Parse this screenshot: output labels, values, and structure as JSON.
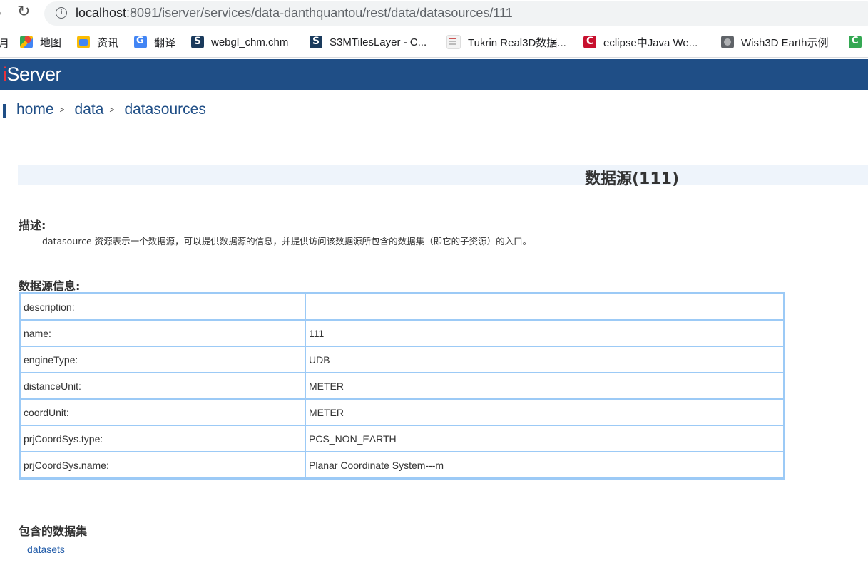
{
  "browser": {
    "url_host": "localhost",
    "url_path": ":8091/iserver/services/data-danthquantou/rest/data/datasources/111",
    "bookmarks_cut": "月",
    "bookmarks": [
      {
        "label": "地图",
        "icon": "maps-icon"
      },
      {
        "label": "资讯",
        "icon": "news-icon"
      },
      {
        "label": "翻译",
        "icon": "translate-icon"
      },
      {
        "label": "webgl_chm.chm",
        "icon": "supermap-icon"
      },
      {
        "label": "S3MTilesLayer - C...",
        "icon": "supermap-icon"
      },
      {
        "label": "Tukrin Real3D数据...",
        "icon": "document-icon"
      },
      {
        "label": "eclipse中Java We...",
        "icon": "eclipse-icon"
      },
      {
        "label": "Wish3D Earth示例",
        "icon": "globe-icon"
      }
    ]
  },
  "header": {
    "logo_i": "i",
    "logo_rest": "Server"
  },
  "breadcrumb": {
    "items": [
      "home",
      "data",
      "datasources"
    ],
    "sep": ">"
  },
  "page": {
    "title": "数据源(111)",
    "desc_heading": "描述:",
    "desc_text": "datasource 资源表示一个数据源，可以提供数据源的信息，并提供访问该数据源所包含的数据集（即它的子资源）的入口。",
    "info_heading": "数据源信息:",
    "info_rows": [
      {
        "key": "description:",
        "value": ""
      },
      {
        "key": "name:",
        "value": "111"
      },
      {
        "key": "engineType:",
        "value": "UDB"
      },
      {
        "key": "distanceUnit:",
        "value": "METER"
      },
      {
        "key": "coordUnit:",
        "value": "METER"
      },
      {
        "key": "prjCoordSys.type:",
        "value": "PCS_NON_EARTH"
      },
      {
        "key": "prjCoordSys.name:",
        "value": "Planar Coordinate System---m"
      }
    ],
    "datasets_heading": "包含的数据集",
    "datasets_link": "datasets"
  },
  "colors": {
    "brand": "#1f4e86",
    "table_border": "#9ccaf6",
    "link": "#1f5aa8"
  }
}
